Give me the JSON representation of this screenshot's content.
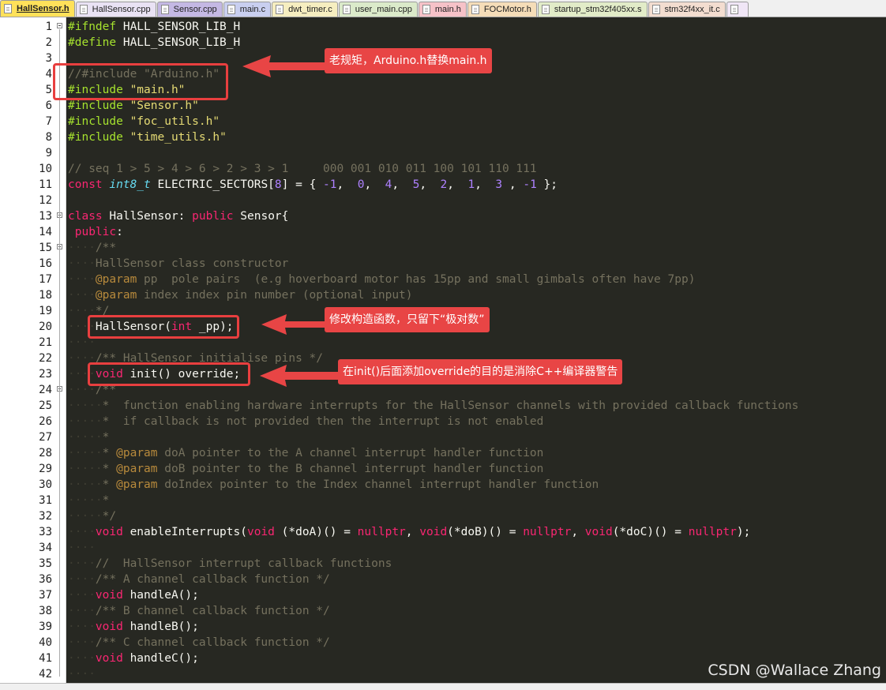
{
  "tabs": [
    {
      "label": "HallSensor.h",
      "color": "#ffe15a",
      "active": true
    },
    {
      "label": "HallSensor.cpp",
      "color": "#e9e2f4"
    },
    {
      "label": "Sensor.cpp",
      "color": "#c4b8e4"
    },
    {
      "label": "main.c",
      "color": "#c9cff0"
    },
    {
      "label": "dwt_timer.c",
      "color": "#f6eec0"
    },
    {
      "label": "user_main.cpp",
      "color": "#dbeaca"
    },
    {
      "label": "main.h",
      "color": "#f6c2c8"
    },
    {
      "label": "FOCMotor.h",
      "color": "#f5ddb8"
    },
    {
      "label": "startup_stm32f405xx.s",
      "color": "#e2ecc8"
    },
    {
      "label": "stm32f4xx_it.c",
      "color": "#f3ddd0"
    },
    {
      "label": "",
      "color": "#f0e6f6"
    }
  ],
  "lines": [
    {
      "n": 1,
      "fold": "box",
      "t": [
        [
          "pp",
          "#ifndef"
        ],
        [
          "p",
          " HALL_SENSOR_LIB_H"
        ]
      ]
    },
    {
      "n": 2,
      "t": [
        [
          "pp",
          "#define"
        ],
        [
          "p",
          " HALL_SENSOR_LIB_H"
        ]
      ]
    },
    {
      "n": 3,
      "t": []
    },
    {
      "n": 4,
      "t": [
        [
          "cm",
          "//#include \"Arduino.h\""
        ]
      ]
    },
    {
      "n": 5,
      "t": [
        [
          "pp",
          "#include"
        ],
        [
          "p",
          " "
        ],
        [
          "str",
          "\"main.h\""
        ]
      ]
    },
    {
      "n": 6,
      "t": [
        [
          "pp",
          "#include"
        ],
        [
          "p",
          " "
        ],
        [
          "str",
          "\"Sensor.h\""
        ]
      ]
    },
    {
      "n": 7,
      "t": [
        [
          "pp",
          "#include"
        ],
        [
          "p",
          " "
        ],
        [
          "str",
          "\"foc_utils.h\""
        ]
      ]
    },
    {
      "n": 8,
      "t": [
        [
          "pp",
          "#include"
        ],
        [
          "p",
          " "
        ],
        [
          "str",
          "\"time_utils.h\""
        ]
      ]
    },
    {
      "n": 9,
      "t": []
    },
    {
      "n": 10,
      "t": [
        [
          "cm",
          "// seq 1 > 5 > 4 > 6 > 2 > 3 > 1     000 001 010 011 100 101 110 111"
        ]
      ]
    },
    {
      "n": 11,
      "t": [
        [
          "kw",
          "const"
        ],
        [
          "p",
          " "
        ],
        [
          "ty",
          "int8_t"
        ],
        [
          "p",
          " ELECTRIC_SECTORS["
        ],
        [
          "num",
          "8"
        ],
        [
          "p",
          "] = { "
        ],
        [
          "num",
          "-1"
        ],
        [
          "p",
          ",  "
        ],
        [
          "num",
          "0"
        ],
        [
          "p",
          ",  "
        ],
        [
          "num",
          "4"
        ],
        [
          "p",
          ",  "
        ],
        [
          "num",
          "5"
        ],
        [
          "p",
          ",  "
        ],
        [
          "num",
          "2"
        ],
        [
          "p",
          ",  "
        ],
        [
          "num",
          "1"
        ],
        [
          "p",
          ",  "
        ],
        [
          "num",
          "3"
        ],
        [
          "p",
          " , "
        ],
        [
          "num",
          "-1"
        ],
        [
          "p",
          " };"
        ]
      ]
    },
    {
      "n": 12,
      "t": []
    },
    {
      "n": 13,
      "fold": "box",
      "t": [
        [
          "kw",
          "class"
        ],
        [
          "p",
          " HallSensor: "
        ],
        [
          "kw",
          "public"
        ],
        [
          "p",
          " Sensor{"
        ]
      ]
    },
    {
      "n": 14,
      "t": [
        [
          "p",
          " "
        ],
        [
          "kw",
          "public"
        ],
        [
          "p",
          ":"
        ]
      ]
    },
    {
      "n": 15,
      "fold": "box",
      "t": [
        [
          "dot",
          "····"
        ],
        [
          "cm",
          "/**"
        ]
      ]
    },
    {
      "n": 16,
      "t": [
        [
          "dot",
          "····"
        ],
        [
          "cm",
          "HallSensor class constructor"
        ]
      ]
    },
    {
      "n": 17,
      "t": [
        [
          "dot",
          "····"
        ],
        [
          "tag",
          "@param"
        ],
        [
          "cm",
          " pp  pole pairs  (e.g hoverboard motor has 15pp and small gimbals often have 7pp)"
        ]
      ]
    },
    {
      "n": 18,
      "t": [
        [
          "dot",
          "····"
        ],
        [
          "tag",
          "@param"
        ],
        [
          "cm",
          " index index pin number (optional input)"
        ]
      ]
    },
    {
      "n": 19,
      "t": [
        [
          "dot",
          "····"
        ],
        [
          "cm",
          "*/"
        ]
      ]
    },
    {
      "n": 20,
      "t": [
        [
          "dot",
          "····"
        ],
        [
          "p",
          "HallSensor("
        ],
        [
          "kw",
          "int"
        ],
        [
          "p",
          " _pp);"
        ]
      ]
    },
    {
      "n": 21,
      "t": [
        [
          "dot",
          "····"
        ]
      ]
    },
    {
      "n": 22,
      "t": [
        [
          "dot",
          "····"
        ],
        [
          "cm",
          "/** HallSensor initialise pins */"
        ]
      ]
    },
    {
      "n": 23,
      "t": [
        [
          "dot",
          "····"
        ],
        [
          "kw",
          "void"
        ],
        [
          "p",
          " init() override;"
        ]
      ]
    },
    {
      "n": 24,
      "fold": "box",
      "t": [
        [
          "dot",
          "····"
        ],
        [
          "cm",
          "/**"
        ]
      ]
    },
    {
      "n": 25,
      "t": [
        [
          "dot",
          "·····"
        ],
        [
          "cm",
          "*  function enabling hardware interrupts for the HallSensor channels with provided callback functions"
        ]
      ]
    },
    {
      "n": 26,
      "t": [
        [
          "dot",
          "·····"
        ],
        [
          "cm",
          "*  if callback is not provided then the interrupt is not enabled"
        ]
      ]
    },
    {
      "n": 27,
      "t": [
        [
          "dot",
          "·····"
        ],
        [
          "cm",
          "*"
        ]
      ]
    },
    {
      "n": 28,
      "t": [
        [
          "dot",
          "·····"
        ],
        [
          "cm",
          "* "
        ],
        [
          "tag",
          "@param"
        ],
        [
          "cm",
          " doA pointer to the A channel interrupt handler function"
        ]
      ]
    },
    {
      "n": 29,
      "t": [
        [
          "dot",
          "·····"
        ],
        [
          "cm",
          "* "
        ],
        [
          "tag",
          "@param"
        ],
        [
          "cm",
          " doB pointer to the B channel interrupt handler function"
        ]
      ]
    },
    {
      "n": 30,
      "t": [
        [
          "dot",
          "·····"
        ],
        [
          "cm",
          "* "
        ],
        [
          "tag",
          "@param"
        ],
        [
          "cm",
          " doIndex pointer to the Index channel interrupt handler function"
        ]
      ]
    },
    {
      "n": 31,
      "t": [
        [
          "dot",
          "·····"
        ],
        [
          "cm",
          "*"
        ]
      ]
    },
    {
      "n": 32,
      "t": [
        [
          "dot",
          "·····"
        ],
        [
          "cm",
          "*/"
        ]
      ]
    },
    {
      "n": 33,
      "t": [
        [
          "dot",
          "····"
        ],
        [
          "kw",
          "void"
        ],
        [
          "p",
          " enableInterrupts("
        ],
        [
          "kw",
          "void"
        ],
        [
          "p",
          " (*doA)() = "
        ],
        [
          "kw",
          "nullptr"
        ],
        [
          "p",
          ", "
        ],
        [
          "kw",
          "void"
        ],
        [
          "p",
          "(*doB)() = "
        ],
        [
          "kw",
          "nullptr"
        ],
        [
          "p",
          ", "
        ],
        [
          "kw",
          "void"
        ],
        [
          "p",
          "(*doC)() = "
        ],
        [
          "kw",
          "nullptr"
        ],
        [
          "p",
          ");"
        ]
      ]
    },
    {
      "n": 34,
      "t": [
        [
          "dot",
          "····"
        ]
      ]
    },
    {
      "n": 35,
      "t": [
        [
          "dot",
          "····"
        ],
        [
          "cm",
          "//  HallSensor interrupt callback functions"
        ]
      ]
    },
    {
      "n": 36,
      "t": [
        [
          "dot",
          "····"
        ],
        [
          "cm",
          "/** A channel callback function */"
        ]
      ]
    },
    {
      "n": 37,
      "t": [
        [
          "dot",
          "····"
        ],
        [
          "kw",
          "void"
        ],
        [
          "p",
          " handleA();"
        ]
      ]
    },
    {
      "n": 38,
      "t": [
        [
          "dot",
          "····"
        ],
        [
          "cm",
          "/** B channel callback function */"
        ]
      ]
    },
    {
      "n": 39,
      "t": [
        [
          "dot",
          "····"
        ],
        [
          "kw",
          "void"
        ],
        [
          "p",
          " handleB();"
        ]
      ]
    },
    {
      "n": 40,
      "t": [
        [
          "dot",
          "····"
        ],
        [
          "cm",
          "/** C channel callback function */"
        ]
      ]
    },
    {
      "n": 41,
      "t": [
        [
          "dot",
          "····"
        ],
        [
          "kw",
          "void"
        ],
        [
          "p",
          " handleC();"
        ]
      ]
    },
    {
      "n": 42,
      "t": [
        [
          "dot",
          "····"
        ]
      ]
    }
  ],
  "annotations": [
    {
      "text": "老规矩，Arduino.h替换main.h"
    },
    {
      "text": "修改构造函数，只留下“极对数”"
    },
    {
      "text": "在init()后面添加override的目的是消除C++编译器警告"
    }
  ],
  "watermark": "CSDN @Wallace Zhang",
  "colors": {
    "editor_bg": "#272822",
    "highlight": "#e83f3f",
    "callout_bg": "#e84545"
  }
}
